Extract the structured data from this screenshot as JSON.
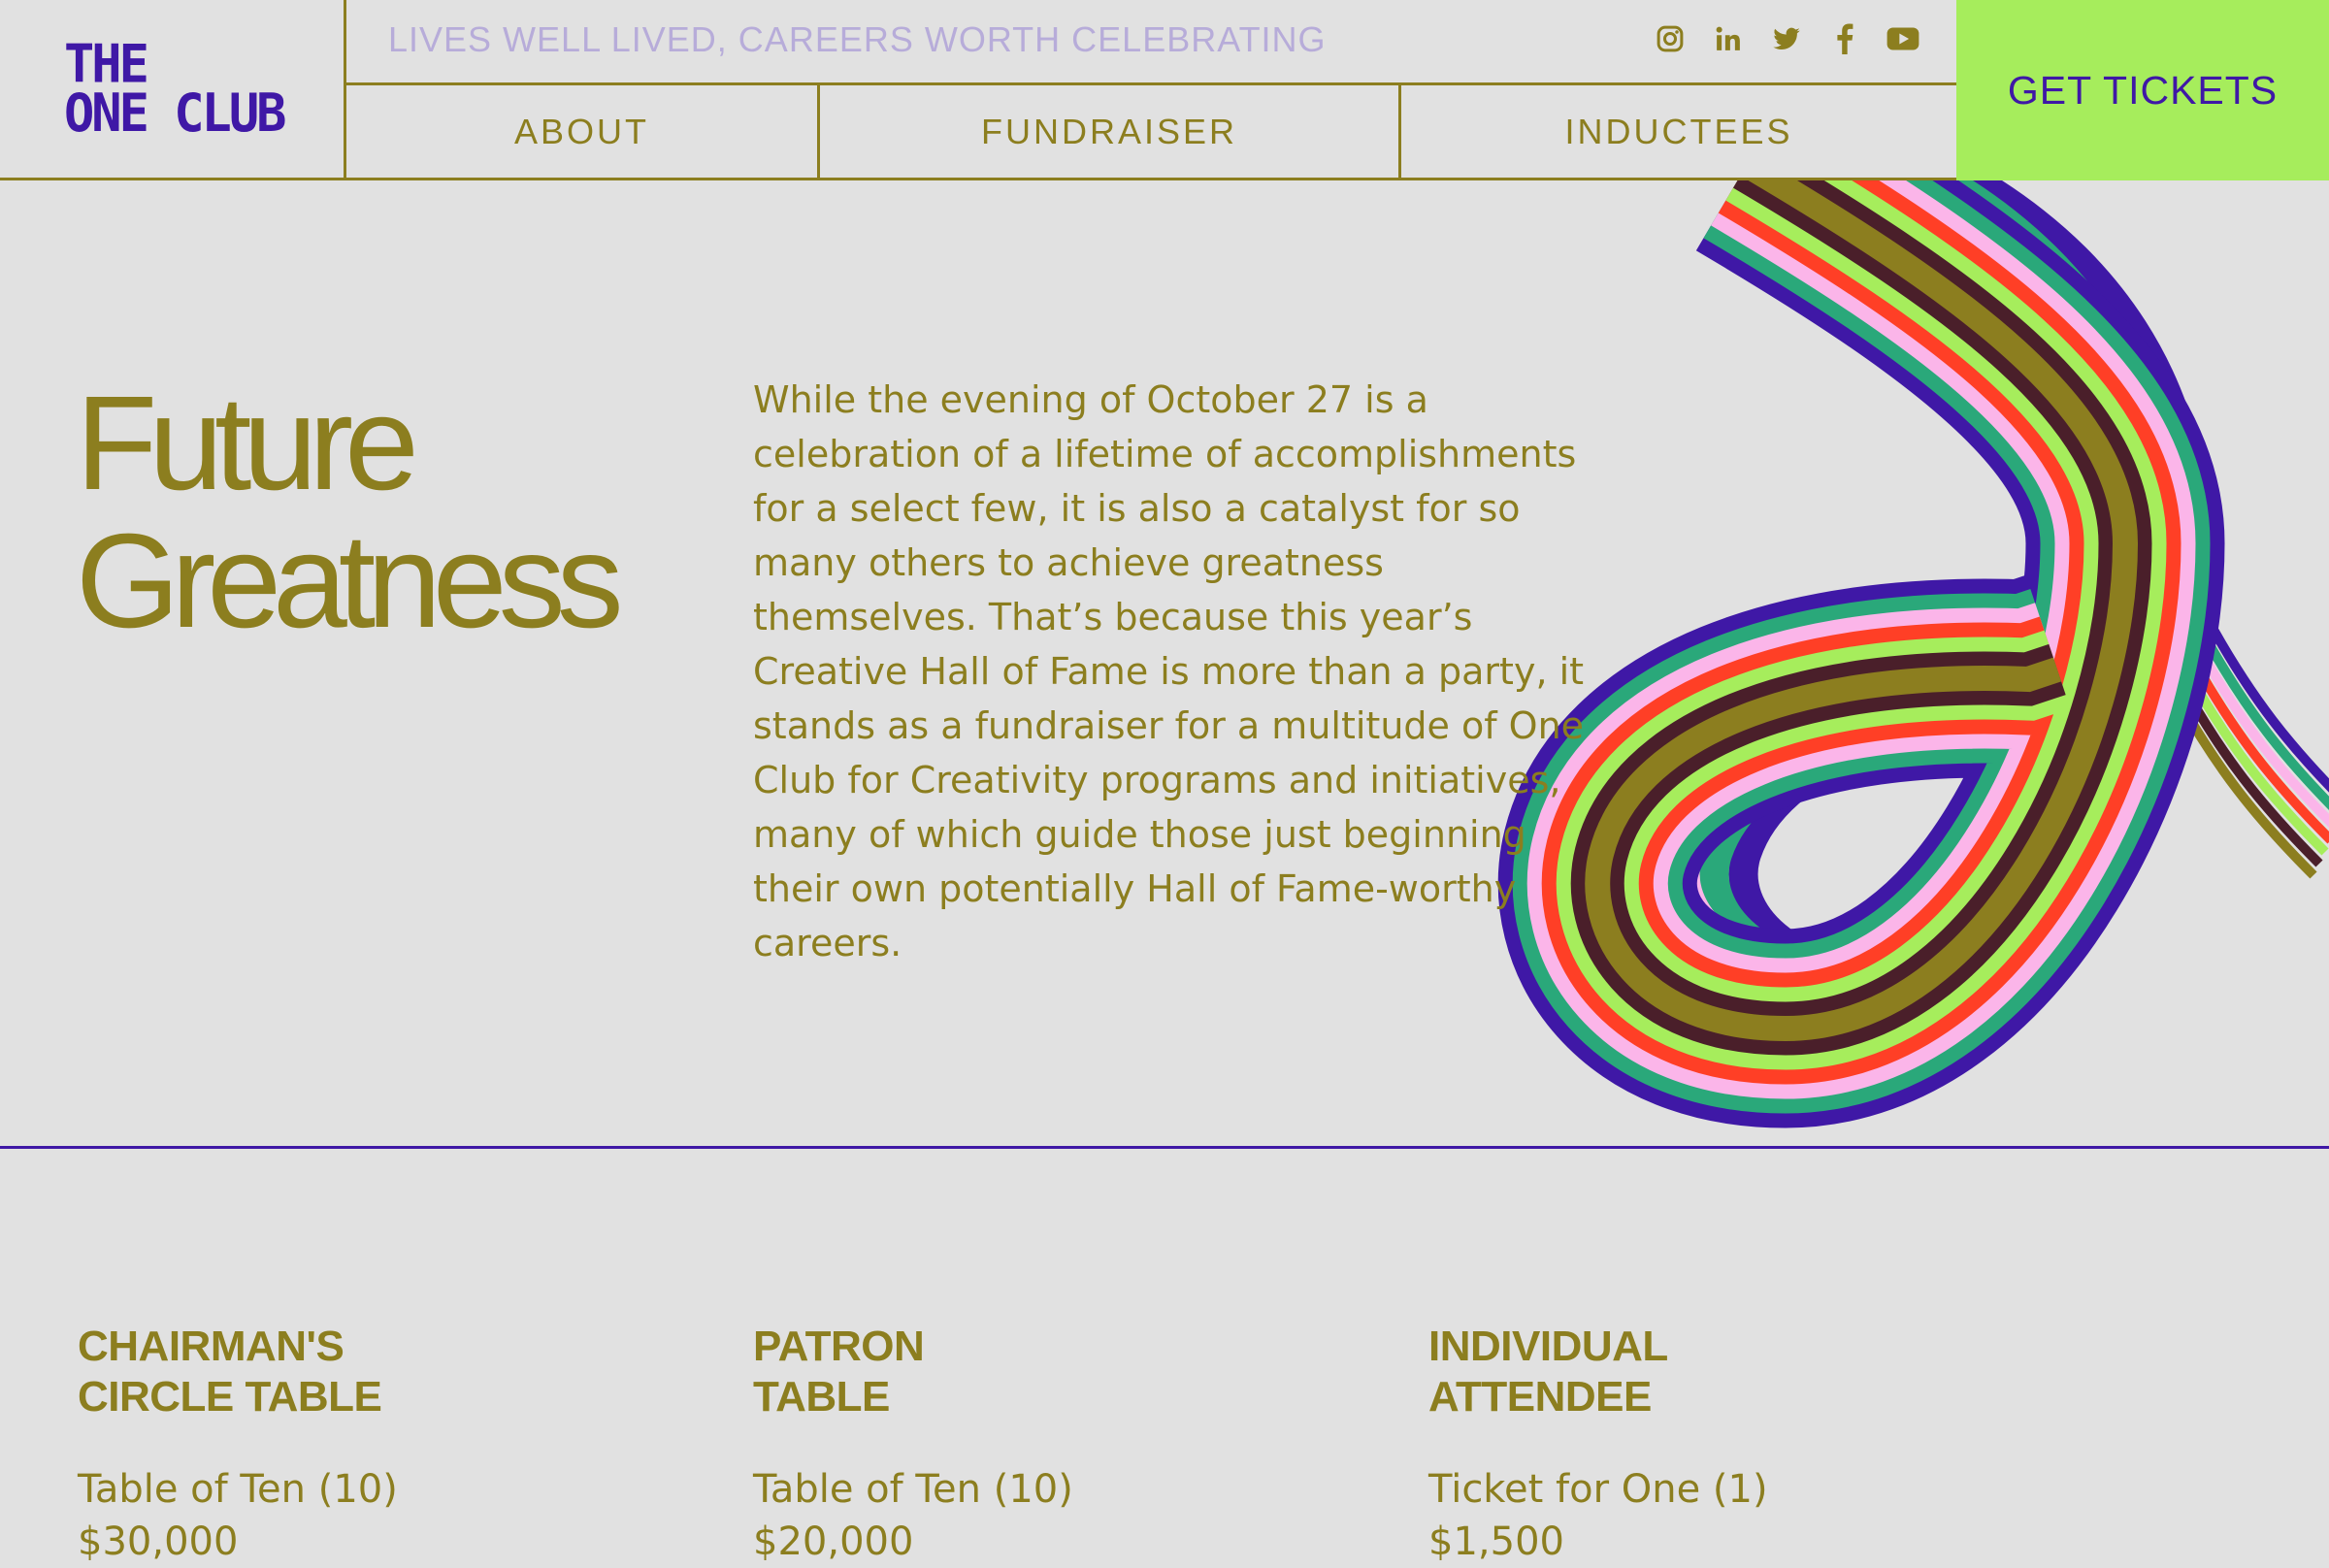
{
  "logo": {
    "line1": "THE",
    "line2": "ONE CLUB"
  },
  "tagline": "LIVES WELL LIVED, CAREERS WORTH CELEBRATING",
  "socials": [
    "instagram-icon",
    "linkedin-icon",
    "twitter-icon",
    "facebook-icon",
    "youtube-icon"
  ],
  "nav": {
    "items": [
      {
        "label": "ABOUT"
      },
      {
        "label": "FUNDRAISER"
      },
      {
        "label": "INDUCTEES"
      }
    ]
  },
  "cta": {
    "label": "GET TICKETS"
  },
  "hero": {
    "title_line1": "Future",
    "title_line2": "Greatness",
    "body": "While the evening of October 27 is a celebration of a lifetime of accomplishments for a select few, it is also a catalyst for so many others to achieve greatness themselves. That’s because this year’s Creative Hall of Fame is more than a party, it stands as a fundraiser for a multitude of One Club for Creativity programs and initiatives, many of which guide those just beginning their own potentially Hall of Fame-worthy careers."
  },
  "tiers": [
    {
      "title_line1": "CHAIRMAN'S",
      "title_line2": "CIRCLE TABLE",
      "desc": "Table of Ten (10)",
      "price": "$30,000"
    },
    {
      "title_line1": "PATRON",
      "title_line2": "TABLE",
      "desc": "Table of Ten (10)",
      "price": "$20,000"
    },
    {
      "title_line1": "INDIVIDUAL",
      "title_line2": "ATTENDEE",
      "desc": "Ticket for One (1)",
      "price": "$1,500"
    }
  ],
  "colors": {
    "background": "#e1e1e1",
    "olive": "#8c7e1f",
    "purple": "#3f18a6",
    "cta_green": "#a6ed5c",
    "ribbon": [
      "#3f18a6",
      "#2aa87a",
      "#fbb5e9",
      "#ff3f26",
      "#a6ed5c",
      "#4a1f2a",
      "#8c7e1f"
    ]
  }
}
